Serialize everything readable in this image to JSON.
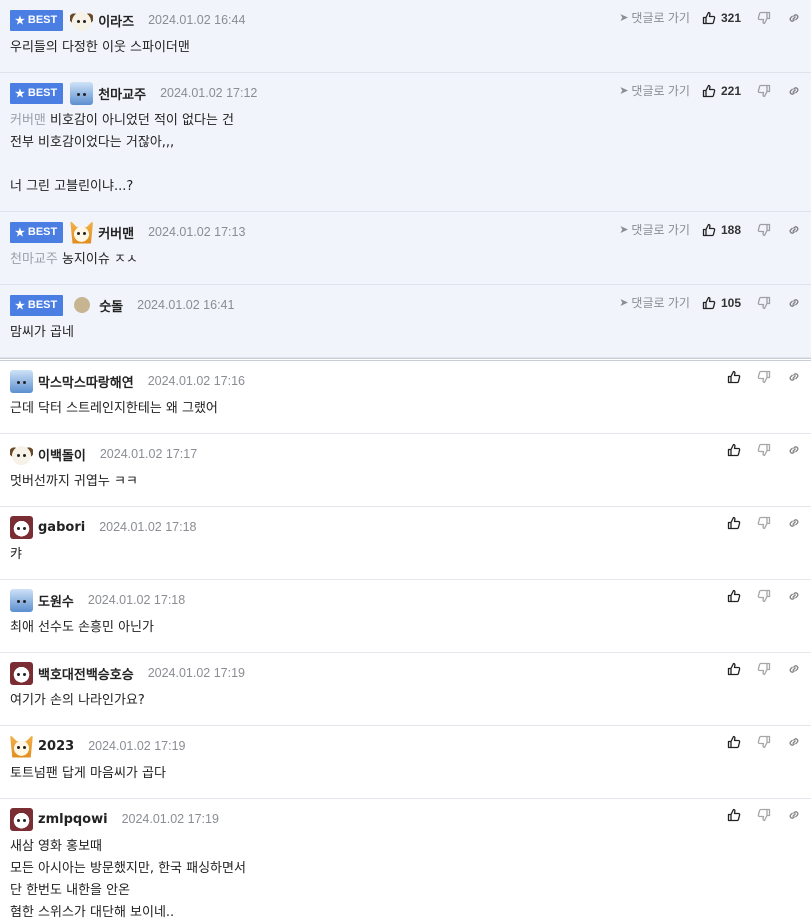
{
  "labels": {
    "best": "BEST",
    "goto": "댓글로 가기"
  },
  "comments": [
    {
      "best": true,
      "avatar": "puppy",
      "nick": "이라즈",
      "date": "2024.01.02 16:44",
      "likes": "321",
      "mention": "",
      "text": "우리들의 다정한 이웃 스파이더맨"
    },
    {
      "best": true,
      "avatar": "bear",
      "nick": "천마교주",
      "date": "2024.01.02 17:12",
      "likes": "221",
      "mention": "커버맨",
      "text": " 비호감이 아니었던 적이 없다는 건\n전부 비호감이었다는 거잖아,,,\n\n너 그린 고블린이냐...?"
    },
    {
      "best": true,
      "avatar": "fox",
      "nick": "커버맨",
      "date": "2024.01.02 17:13",
      "likes": "188",
      "mention": "천마교주",
      "text": " 농지이슈 ㅈㅅ"
    },
    {
      "best": true,
      "avatar": "dot",
      "nick": "숫돌",
      "date": "2024.01.02 16:41",
      "likes": "105",
      "mention": "",
      "text": "맘씨가 곱네"
    },
    {
      "best": false,
      "avatar": "bear",
      "nick": "막스막스따랑해연",
      "date": "2024.01.02 17:16",
      "likes": "",
      "mention": "",
      "text": "근데 닥터 스트레인지한테는 왜 그랬어"
    },
    {
      "best": false,
      "avatar": "puppy",
      "nick": "이백돌이",
      "date": "2024.01.02 17:17",
      "likes": "",
      "mention": "",
      "text": "멋버선까지 귀엽누 ㅋㅋ"
    },
    {
      "best": false,
      "avatar": "panda",
      "nick": "gabori",
      "date": "2024.01.02 17:18",
      "likes": "",
      "mention": "",
      "text": "캬"
    },
    {
      "best": false,
      "avatar": "bear",
      "nick": "도원수",
      "date": "2024.01.02 17:18",
      "likes": "",
      "mention": "",
      "text": "최애 선수도 손흥민 아닌가"
    },
    {
      "best": false,
      "avatar": "panda",
      "nick": "백호대전백승호승",
      "date": "2024.01.02 17:19",
      "likes": "",
      "mention": "",
      "text": "여기가 손의 나라인가요?"
    },
    {
      "best": false,
      "avatar": "fox",
      "nick": "2023",
      "date": "2024.01.02 17:19",
      "likes": "",
      "mention": "",
      "text": "토트넘팬 답게 마음씨가 곱다"
    },
    {
      "best": false,
      "avatar": "panda",
      "nick": "zmlpqowi",
      "date": "2024.01.02 17:19",
      "likes": "",
      "mention": "",
      "text": "새삼 영화 홍보때\n모든 아시아는 방문했지만, 한국 패싱하면서\n단 한번도 내한을 안온\n혐한 스위스가 대단해 보이네.."
    }
  ]
}
